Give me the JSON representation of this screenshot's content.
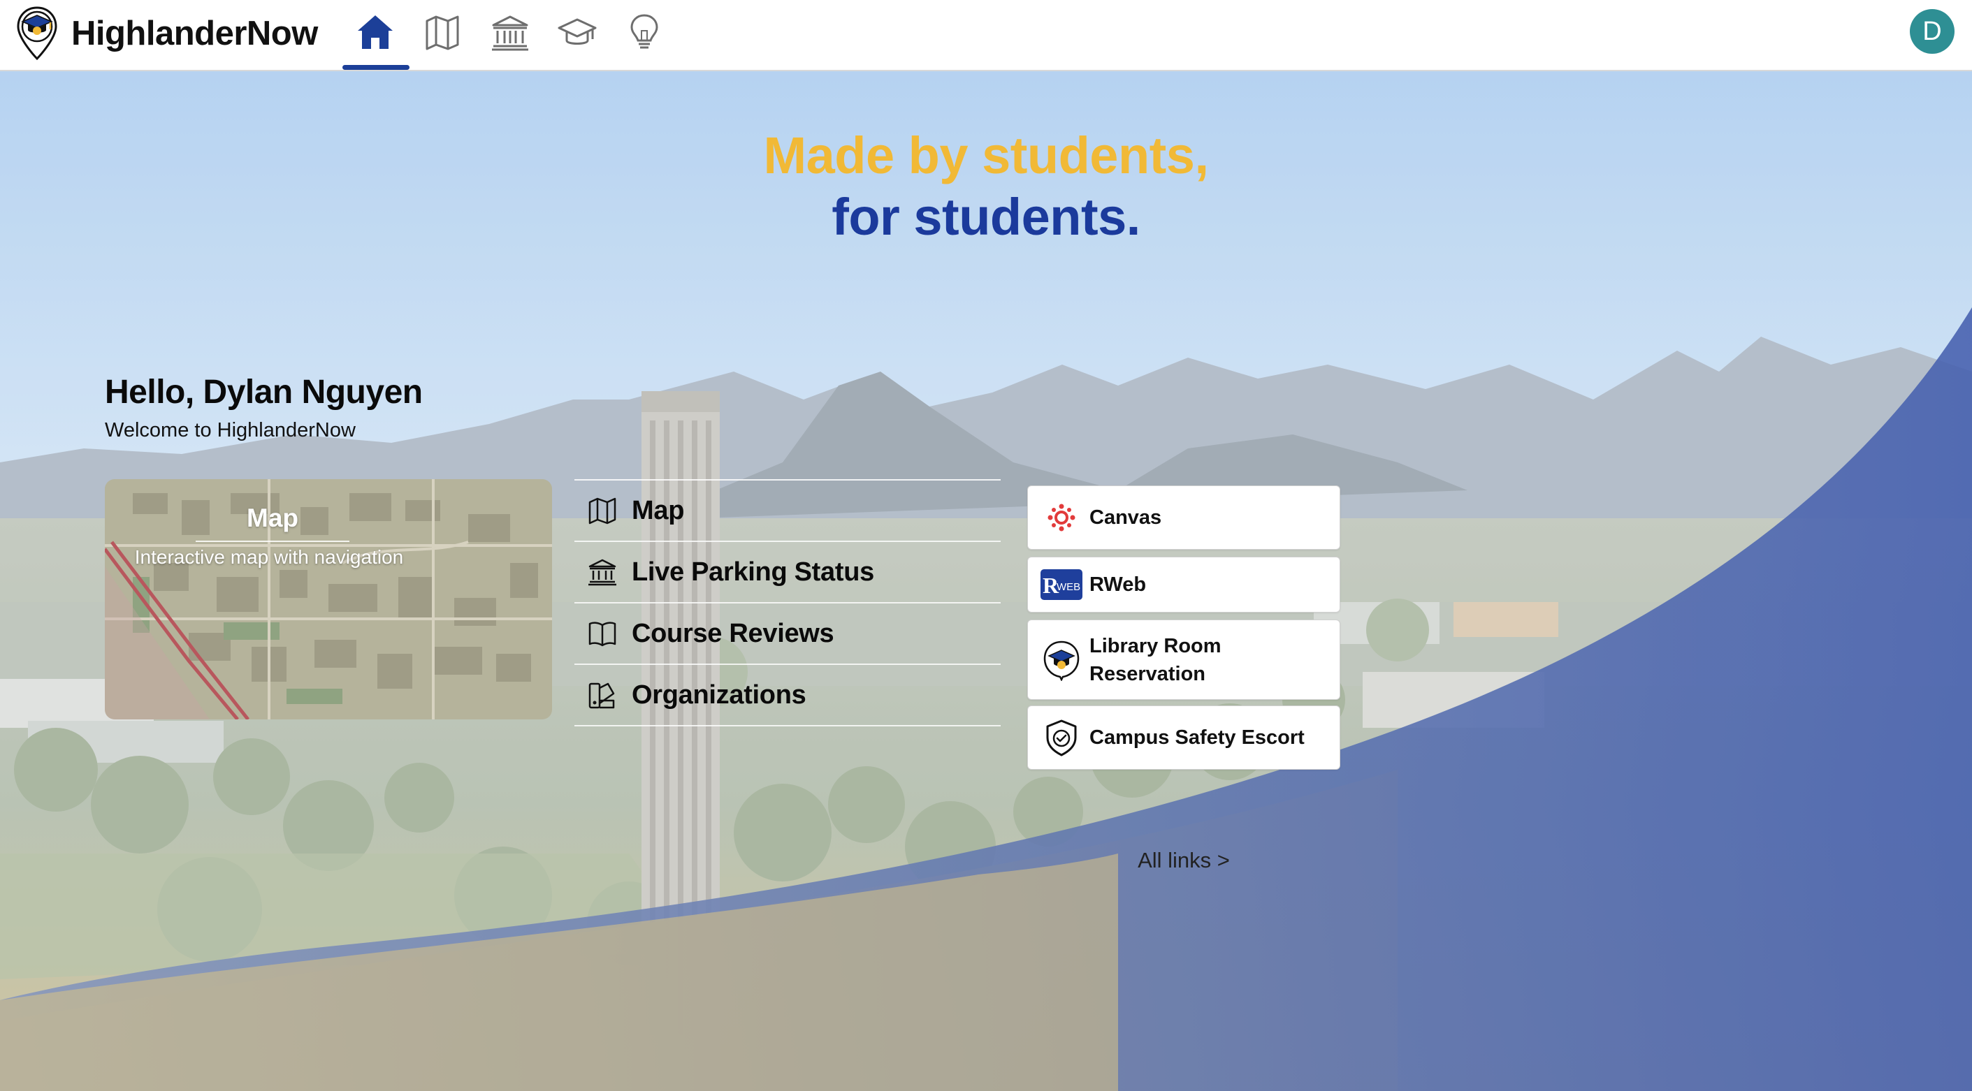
{
  "app": {
    "name": "HighlanderNow",
    "logo_icon": "mortarboard-pin-icon"
  },
  "nav": {
    "items": [
      {
        "icon": "home-icon",
        "active": true
      },
      {
        "icon": "map-icon",
        "active": false
      },
      {
        "icon": "building-icon",
        "active": false
      },
      {
        "icon": "graduation-cap-icon",
        "active": false
      },
      {
        "icon": "lightbulb-icon",
        "active": false
      }
    ],
    "accent_color": "#1c3f98"
  },
  "user": {
    "avatar_initial": "D",
    "avatar_color": "#2e8f94"
  },
  "hero": {
    "headline_line1": "Made by students,",
    "headline_line2": "for students.",
    "headline_line1_color": "#f1b936",
    "headline_line2_color": "#1b3a9c"
  },
  "greeting": {
    "title": "Hello, Dylan Nguyen",
    "subtitle": "Welcome to HighlanderNow"
  },
  "map_card": {
    "title": "Map",
    "subtitle": "Interactive map with navigation"
  },
  "features": [
    {
      "label": "Map",
      "icon": "map-icon"
    },
    {
      "label": "Live Parking Status",
      "icon": "building-icon"
    },
    {
      "label": "Course Reviews",
      "icon": "book-icon"
    },
    {
      "label": "Organizations",
      "icon": "swatch-icon"
    }
  ],
  "quick_links": [
    {
      "label": "Canvas",
      "icon": "canvas-icon"
    },
    {
      "label": "RWeb",
      "icon": "rweb-icon",
      "badge_text": "WEB",
      "badge_letter": "R"
    },
    {
      "label_line1": "Library Room",
      "label_line2": "Reservation",
      "icon": "library-reservation-icon"
    },
    {
      "label": "Campus Safety Escort",
      "icon": "shield-check-icon"
    }
  ],
  "all_links_label": "All links >"
}
